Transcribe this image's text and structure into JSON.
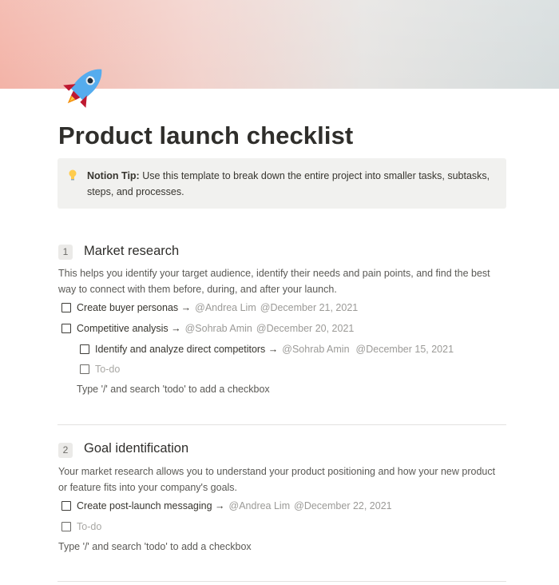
{
  "page": {
    "title": "Product launch checklist",
    "icon": "rocket-icon"
  },
  "callout": {
    "icon": "lightbulb-icon",
    "bold": "Notion Tip:",
    "text": " Use this template to break down the entire project into smaller tasks, subtasks, steps, and processes."
  },
  "sections": [
    {
      "number": "1",
      "heading": "Market research",
      "description": "This helps you identify your target audience, identify their needs and pain points, and find the best way to connect with them before, during, and after your launch.",
      "todos": [
        {
          "label": "Create buyer personas →",
          "person": "@Andrea Lim",
          "date": "@December 21, 2021"
        },
        {
          "label": "Competitive analysis →",
          "person": "@Sohrab Amin",
          "date": "@December 20, 2021"
        },
        {
          "label": "Identify and analyze direct competitors →",
          "person": "@Sohrab Amin",
          "date": "@December 15, 2021"
        },
        {
          "label": "To-do"
        }
      ],
      "hint": "Type '/' and search 'todo' to add a checkbox"
    },
    {
      "number": "2",
      "heading": "Goal identification",
      "description": "Your market research allows you to understand your product positioning and how your new product or feature fits into your company's goals.",
      "todos": [
        {
          "label": "Create post-launch messaging →",
          "person": "@Andrea Lim",
          "date": "@December 22, 2021"
        },
        {
          "label": "To-do"
        }
      ],
      "hint": "Type '/' and search 'todo' to add a checkbox"
    }
  ]
}
